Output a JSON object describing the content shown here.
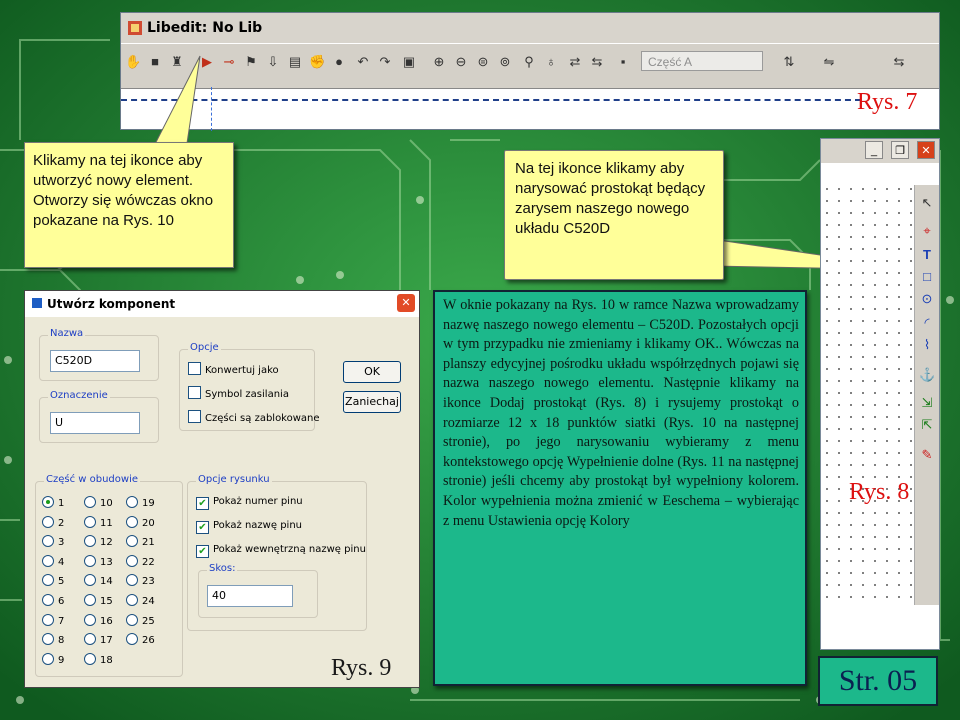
{
  "rys7": {
    "title": "Libedit: No Lib",
    "part_combo": "Część A",
    "label": "Rys. 7"
  },
  "callout_left": {
    "text": "Klikamy na tej ikonce aby utworzyć nowy element. Otworzy się wówczas okno pokazane na Rys. 10"
  },
  "callout_center": {
    "text": "Na tej ikonce klikamy aby narysować prostokąt będący zarysem naszego nowego układu C520D"
  },
  "rys8": {
    "label": "Rys. 8",
    "window_buttons": [
      "_",
      "❐",
      "✕"
    ]
  },
  "dialog": {
    "title": "Utwórz komponent",
    "close": "✕",
    "nazwa_label": "Nazwa",
    "nazwa_value": "C520D",
    "oznaczenie_label": "Oznaczenie",
    "oznaczenie_value": "U",
    "opcje_label": "Opcje",
    "opcje": [
      "Konwertuj jako",
      "Symbol zasilania",
      "Części są zablokowane"
    ],
    "ok": "OK",
    "cancel": "Zaniechaj",
    "czesci_label": "Część w obudowie",
    "radios": [
      "1",
      "2",
      "3",
      "4",
      "5",
      "6",
      "7",
      "8",
      "9",
      "10",
      "11",
      "12",
      "13",
      "14",
      "15",
      "16",
      "17",
      "18",
      "19",
      "20",
      "21",
      "22",
      "23",
      "24",
      "25",
      "26"
    ],
    "selected": "1",
    "rysunek_label": "Opcje rysunku",
    "rysunek": [
      "Pokaż numer pinu",
      "Pokaż nazwę pinu",
      "Pokaż wewnętrzną nazwę pinu"
    ],
    "skos_label": "Skos:",
    "skos_value": "40",
    "label": "Rys. 9"
  },
  "body_text": "W oknie pokazany na Rys. 10 w ramce Nazwa wprowadzamy nazwę naszego nowego elementu – C520D. Pozostałych opcji w tym przypadku nie zmieniamy i klikamy OK.. Wówczas na planszy edycyjnej pośrodku układu współrzędnych pojawi się nazwa naszego nowego elementu. Następnie klikamy na ikonce Dodaj prostokąt (Rys. 8) i rysujemy prostokąt o rozmiarze 12 x 18 punktów siatki (Rys. 10 na następnej stronie), po jego narysowaniu wybieramy z menu kontekstowego opcję Wypełnienie dolne (Rys. 11 na następnej stronie) jeśli chcemy aby prostokąt był wypełniony kolorem. Kolor wypełnienia można zmienić w Eeschema – wybierając z menu Ustawienia opcję Kolory",
  "page_label": "Str. 05",
  "colors": {
    "board": "#1f8a2e",
    "callout": "#ffff99",
    "text_panel": "#1cb88b",
    "red_label": "#dd1111"
  }
}
